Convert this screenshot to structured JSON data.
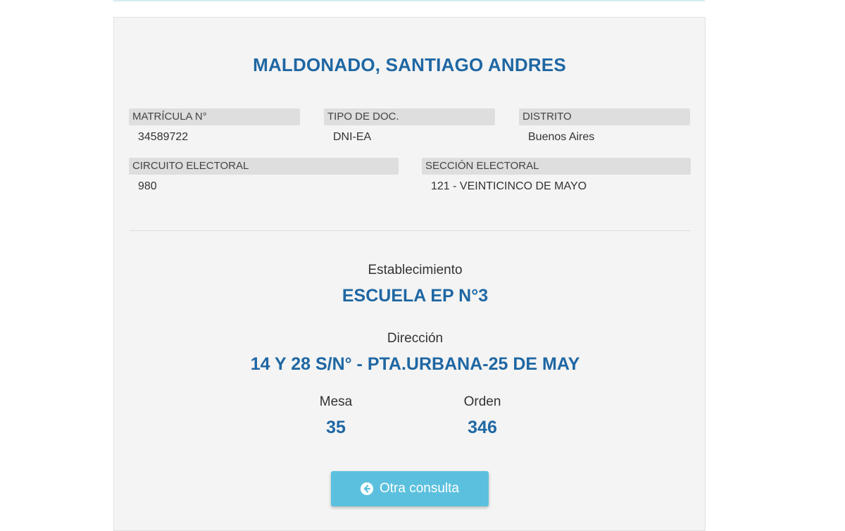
{
  "voter": {
    "name": "MALDONADO, SANTIAGO ANDRES",
    "fields": {
      "matricula": {
        "label": "MATRÍCULA N°",
        "value": "34589722"
      },
      "tipo_doc": {
        "label": "TIPO DE DOC.",
        "value": "DNI-EA"
      },
      "distrito": {
        "label": "DISTRITO",
        "value": "Buenos Aires"
      },
      "circuito": {
        "label": "CIRCUITO ELECTORAL",
        "value": "980"
      },
      "seccion": {
        "label": "SECCIÓN ELECTORAL",
        "value": "121 - VEINTICINCO DE MAYO"
      }
    }
  },
  "location": {
    "establecimiento_label": "Establecimiento",
    "establecimiento_value": "ESCUELA EP N°3",
    "direccion_label": "Dirección",
    "direccion_value": "14 Y 28 S/N° - PTA.URBANA-25 DE MAY",
    "mesa_label": "Mesa",
    "mesa_value": "35",
    "orden_label": "Orden",
    "orden_value": "346"
  },
  "actions": {
    "otra_consulta_label": "Otra consulta",
    "otra_consulta_icon": "arrow-circle-left-icon"
  },
  "colors": {
    "accent": "#1f67a3",
    "button": "#5bc0de",
    "card_bg": "#f4f4f4",
    "label_bg": "#dedede"
  }
}
